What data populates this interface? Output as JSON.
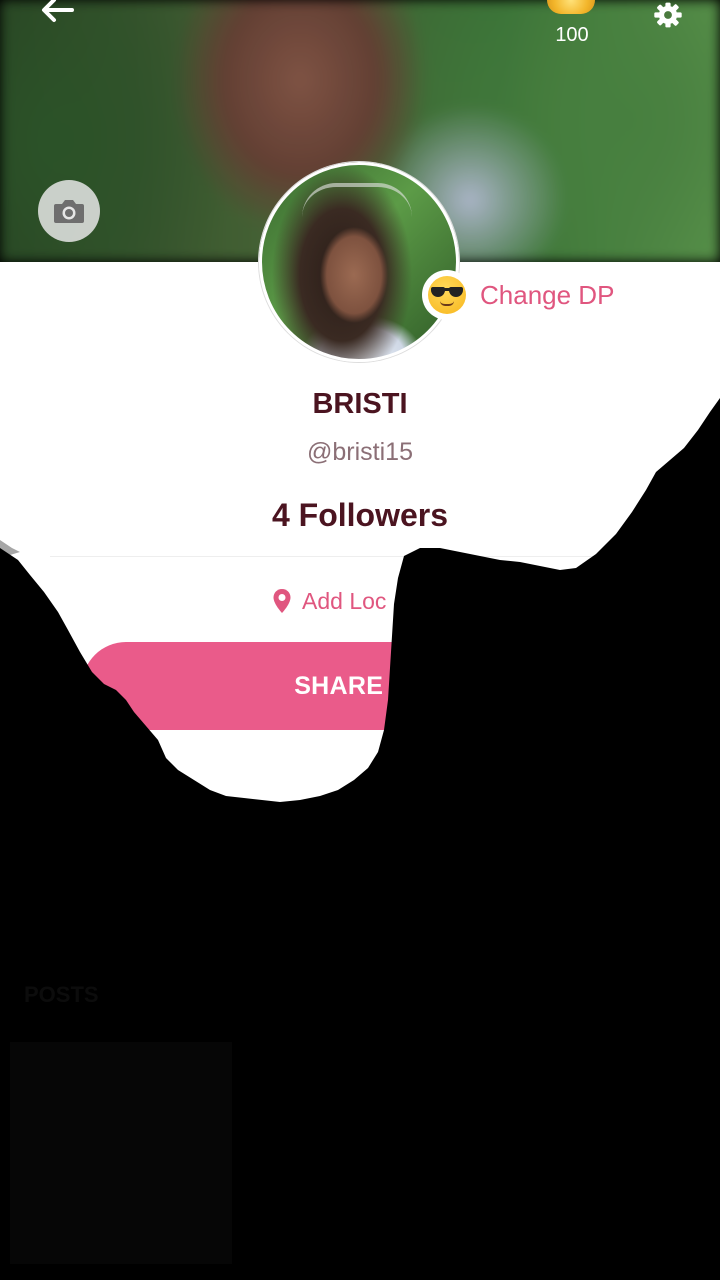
{
  "header": {
    "coins": "100",
    "back_icon": "arrow-left-icon",
    "settings_icon": "gear-icon",
    "coin_icon": "coin-icon",
    "camera_icon": "camera-icon"
  },
  "profile": {
    "change_dp_label": "Change DP",
    "name": "BRISTI",
    "handle": "@bristi15",
    "followers": "4 Followers",
    "location_label": "Add Loc",
    "share_label": "SHARE PR"
  },
  "posts": {
    "label": "POSTS"
  },
  "colors": {
    "accent": "#ea5b8a",
    "accent_text": "#e0567f",
    "name_text": "#4b1420",
    "handle_text": "#8b6f76"
  }
}
